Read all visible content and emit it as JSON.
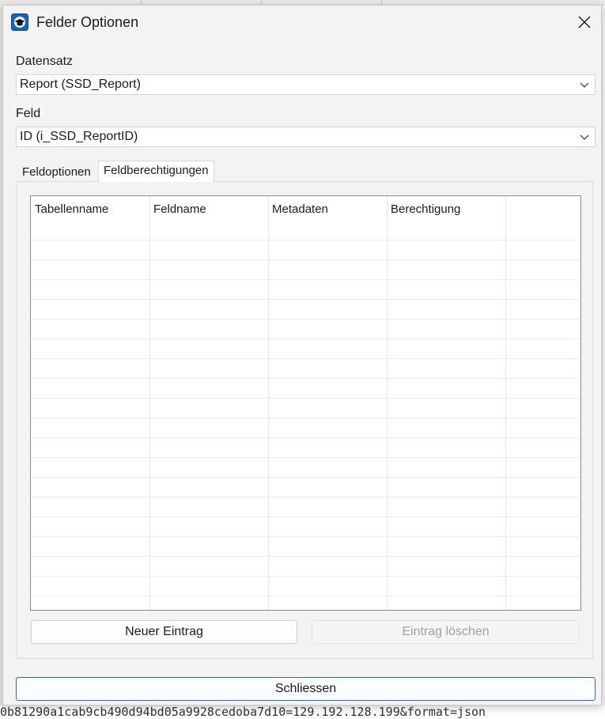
{
  "window": {
    "title": "Felder Optionen"
  },
  "datensatz": {
    "label": "Datensatz",
    "value": "Report (SSD_Report)"
  },
  "feld": {
    "label": "Feld",
    "value": "ID (i_SSD_ReportID)"
  },
  "tabs": [
    {
      "label": "Feldoptionen",
      "active": false
    },
    {
      "label": "Feldberechtigungen",
      "active": true
    }
  ],
  "table": {
    "columns": [
      "Tabellenname",
      "Feldname",
      "Metadaten",
      "Berechtigung"
    ],
    "rows": []
  },
  "buttons": {
    "new_entry": "Neuer Eintrag",
    "delete_entry": "Eintrag löschen",
    "close": "Schliessen"
  },
  "background": {
    "bottom_text": "0b81290a1cab9cb490d94bd05a9928cedoba7d10=129.192.128.199&format=json"
  },
  "colors": {
    "accent": "#2a6fb3",
    "icon_blue": "#1565c0"
  }
}
